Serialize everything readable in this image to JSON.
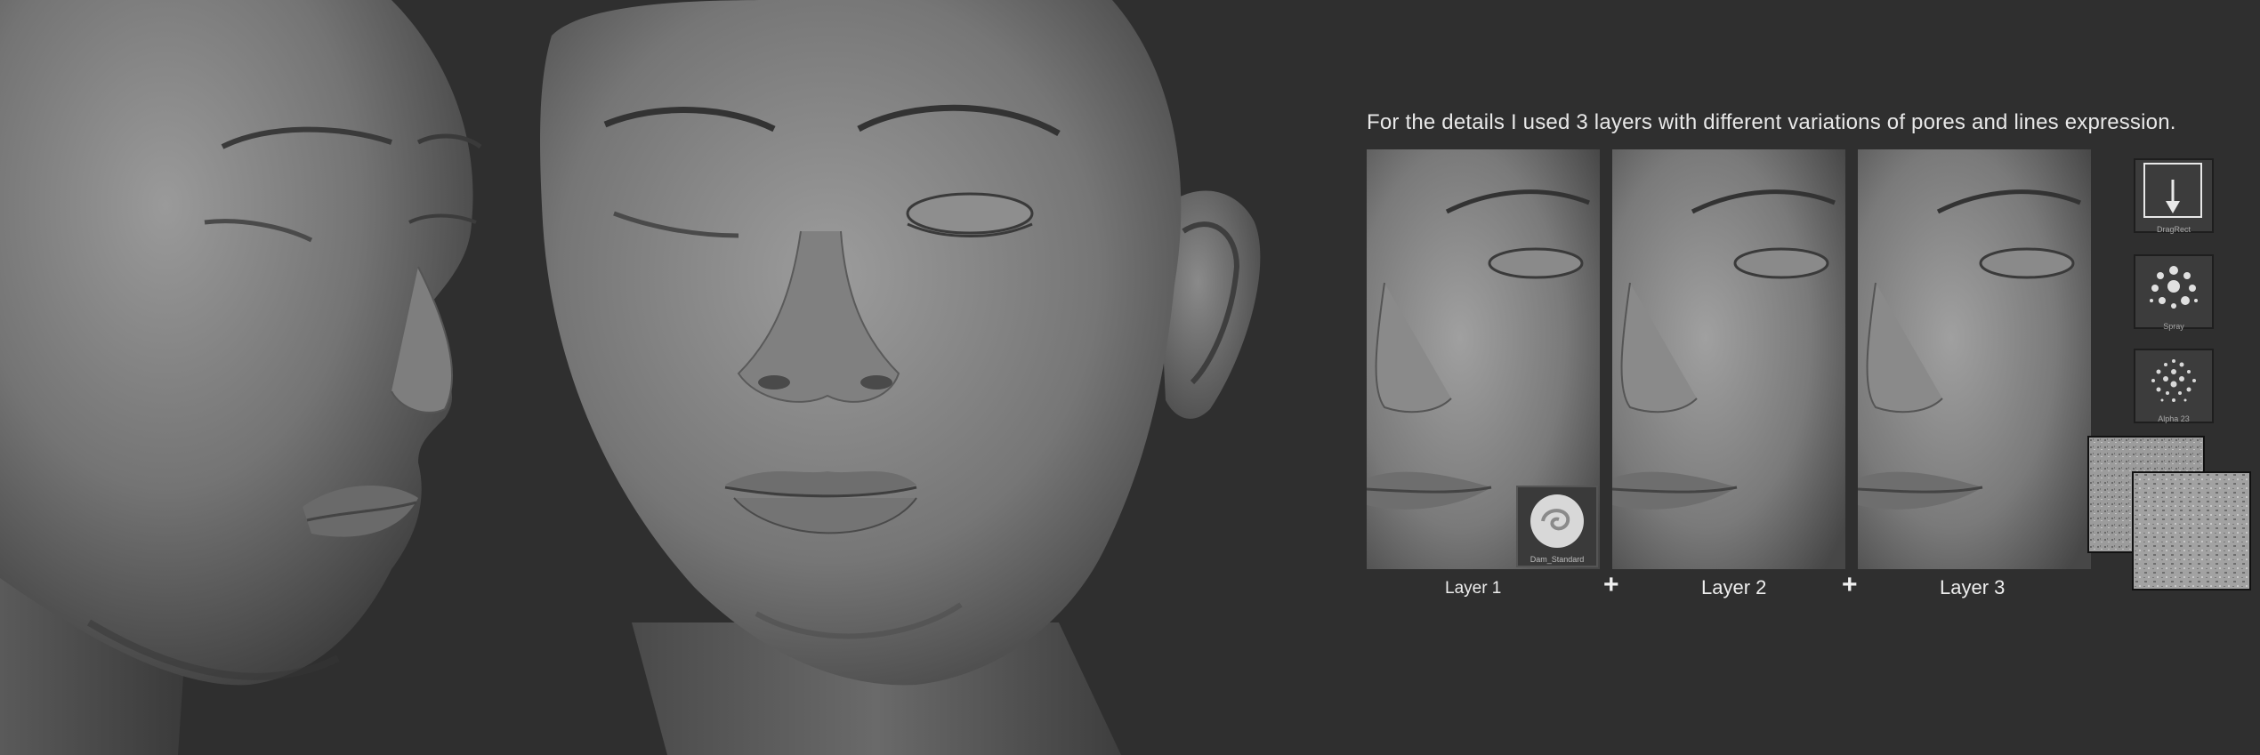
{
  "description_text": "For the details I used 3 layers with different variations of pores and lines expression.",
  "layers": [
    {
      "label": "Layer 1"
    },
    {
      "label": "Layer 2"
    },
    {
      "label": "Layer 3"
    }
  ],
  "plus_sign": "+",
  "brush_thumbnail": {
    "label": "Dam_Standard"
  },
  "tools": [
    {
      "label": "DragRect",
      "icon": "dragrect-arrow-icon"
    },
    {
      "label": "Spray",
      "icon": "spray-dots-icon"
    },
    {
      "label": "Alpha 23",
      "icon": "alpha-dots-icon"
    }
  ],
  "colors": {
    "background": "#2f2f2f",
    "clay_light": "#8a8a8a",
    "clay_mid": "#6c6c6c",
    "clay_dark": "#3a3a3a",
    "text": "#e6e6e6"
  }
}
